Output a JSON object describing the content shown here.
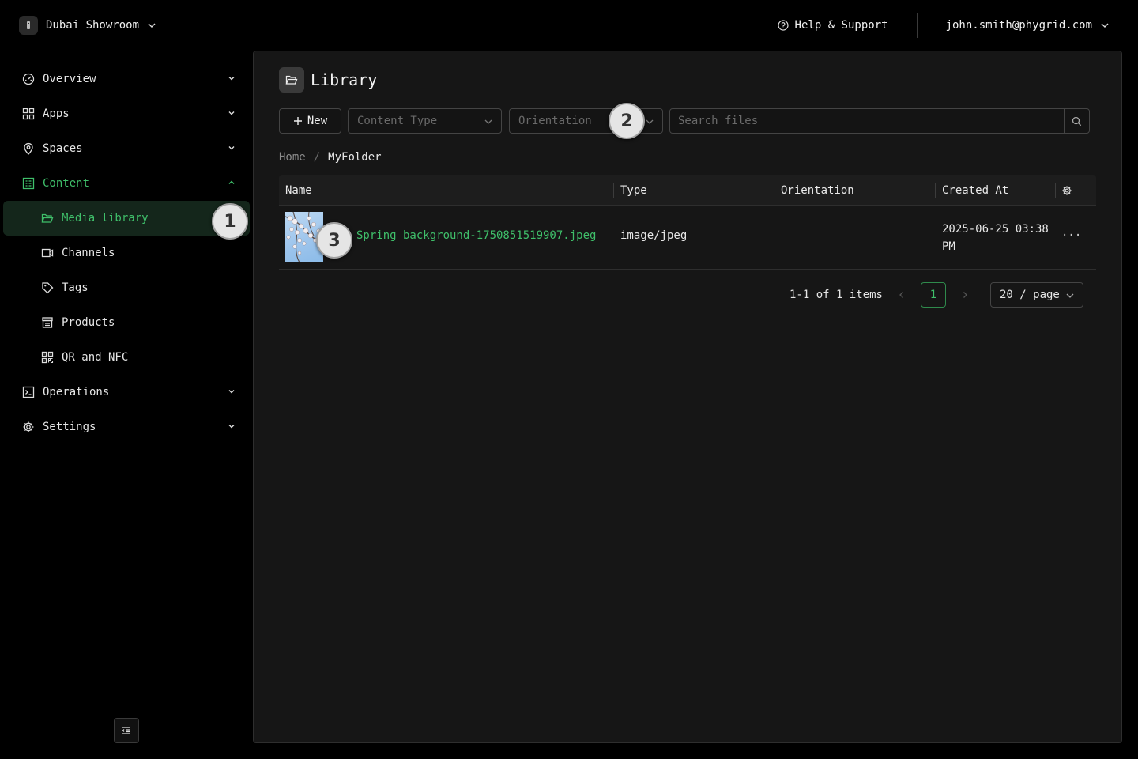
{
  "org": {
    "name": "Dubai Showroom"
  },
  "header": {
    "help_label": "Help & Support",
    "user_email": "john.smith@phygrid.com"
  },
  "sidebar": {
    "items": [
      {
        "label": "Overview",
        "icon": "gauge-icon"
      },
      {
        "label": "Apps",
        "icon": "grid-icon"
      },
      {
        "label": "Spaces",
        "icon": "map-pin-icon"
      },
      {
        "label": "Content",
        "icon": "content-icon",
        "expanded": true
      },
      {
        "label": "Operations",
        "icon": "terminal-icon"
      },
      {
        "label": "Settings",
        "icon": "gear-icon"
      }
    ],
    "content_children": [
      {
        "label": "Media library",
        "icon": "folder-open-icon",
        "selected": true
      },
      {
        "label": "Channels",
        "icon": "video-icon"
      },
      {
        "label": "Tags",
        "icon": "tag-icon"
      },
      {
        "label": "Products",
        "icon": "store-icon"
      },
      {
        "label": "QR and NFC",
        "icon": "qr-icon"
      }
    ]
  },
  "page": {
    "title": "Library"
  },
  "toolbar": {
    "new_label": "New",
    "content_type_placeholder": "Content Type",
    "orientation_placeholder": "Orientation",
    "search_placeholder": "Search files"
  },
  "breadcrumb": {
    "home": "Home",
    "separator": "/",
    "current": "MyFolder"
  },
  "table": {
    "columns": [
      "Name",
      "Type",
      "Orientation",
      "Created At"
    ],
    "rows": [
      {
        "name": "Spring background-1750851519907.jpeg",
        "type": "image/jpeg",
        "orientation": "",
        "created_line1": "2025-06-25 03:38",
        "created_line2": "PM",
        "actions": "···"
      }
    ]
  },
  "pagination": {
    "summary": "1-1 of 1 items",
    "current_page": "1",
    "page_size": "20 / page"
  },
  "markers": [
    "1",
    "2",
    "3"
  ],
  "colors": {
    "accent": "#3fbf6a",
    "background": "#000000",
    "panel": "#161616",
    "selected_bg": "#14261b"
  }
}
